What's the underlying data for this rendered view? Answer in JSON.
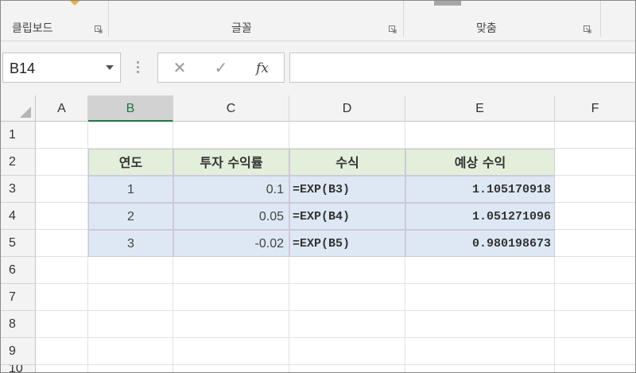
{
  "ribbon": {
    "groups": [
      {
        "label": "클립보드"
      },
      {
        "label": "글꼴"
      },
      {
        "label": "맞춤"
      }
    ]
  },
  "formula_bar": {
    "name_box": "B14",
    "formula": "",
    "cancel_icon": "✕",
    "enter_icon": "✓",
    "fx_label": "fx"
  },
  "grid": {
    "columns": [
      "A",
      "B",
      "C",
      "D",
      "E",
      "F"
    ],
    "rows": [
      "1",
      "2",
      "3",
      "4",
      "5",
      "6",
      "7",
      "8",
      "9",
      "10"
    ],
    "selected_column": "B",
    "table": {
      "headers": [
        "연도",
        "투자 수익률",
        "수식",
        "예상 수익"
      ],
      "rows": [
        {
          "year": "1",
          "rate": "0.1",
          "formula": "=EXP(B3)",
          "result": "1.105170918"
        },
        {
          "year": "2",
          "rate": "0.05",
          "formula": "=EXP(B4)",
          "result": "1.051271096"
        },
        {
          "year": "3",
          "rate": "-0.02",
          "formula": "=EXP(B5)",
          "result": "0.980198673"
        }
      ]
    }
  },
  "colors": {
    "header_fill": "#e2efda",
    "data_fill": "#dde8f4",
    "excel_green": "#217346"
  }
}
